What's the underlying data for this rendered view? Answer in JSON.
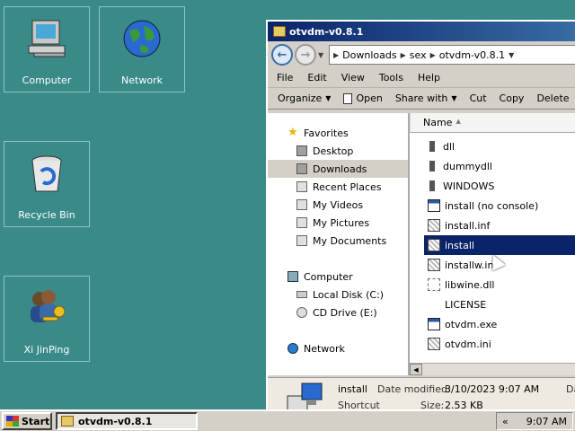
{
  "desktop": {
    "icons": [
      {
        "label": "Computer",
        "icon": "computer-icon"
      },
      {
        "label": "Network",
        "icon": "network-globe-icon"
      },
      {
        "label": "Recycle Bin",
        "icon": "recycle-bin-icon"
      },
      {
        "label": "Xi JinPing",
        "icon": "user-key-icon"
      }
    ]
  },
  "window": {
    "title": "otvdm-v0.8.1",
    "address": {
      "crumbs": [
        "Downloads",
        "sex",
        "otvdm-v0.8.1"
      ]
    },
    "menu": [
      "File",
      "Edit",
      "View",
      "Tools",
      "Help"
    ],
    "toolbar": {
      "organize": "Organize",
      "open": "Open",
      "share_with": "Share with",
      "cut": "Cut",
      "copy": "Copy",
      "delete": "Delete"
    },
    "nav": {
      "favorites": "Favorites",
      "favorites_items": [
        "Desktop",
        "Downloads",
        "Recent Places",
        "My Videos",
        "My Pictures",
        "My Documents"
      ],
      "computer": "Computer",
      "computer_items": [
        "Local Disk (C:)",
        "CD Drive (E:)"
      ],
      "network": "Network",
      "selected": "Downloads"
    },
    "files": {
      "column_name": "Name",
      "items": [
        {
          "name": "dll",
          "type": "folder"
        },
        {
          "name": "dummydll",
          "type": "folder"
        },
        {
          "name": "WINDOWS",
          "type": "folder"
        },
        {
          "name": "install (no console)",
          "type": "exe"
        },
        {
          "name": "install.inf",
          "type": "gear"
        },
        {
          "name": "install",
          "type": "gear",
          "selected": true
        },
        {
          "name": "installw.inf",
          "type": "gear"
        },
        {
          "name": "libwine.dll",
          "type": "dll"
        },
        {
          "name": "LICENSE",
          "type": "blank"
        },
        {
          "name": "otvdm.exe",
          "type": "exe"
        },
        {
          "name": "otvdm.ini",
          "type": "gear"
        }
      ]
    },
    "details": {
      "name": "install",
      "date_label": "Date modified:",
      "date_value": "3/10/2023 9:07 AM",
      "extra": "Da",
      "type_label": "Shortcut",
      "size_label": "Size:",
      "size_value": "2.53 KB"
    }
  },
  "taskbar": {
    "start": "Start",
    "task_title": "otvdm-v0.8.1",
    "tray_arrows": "«",
    "clock": "9:07 AM"
  }
}
